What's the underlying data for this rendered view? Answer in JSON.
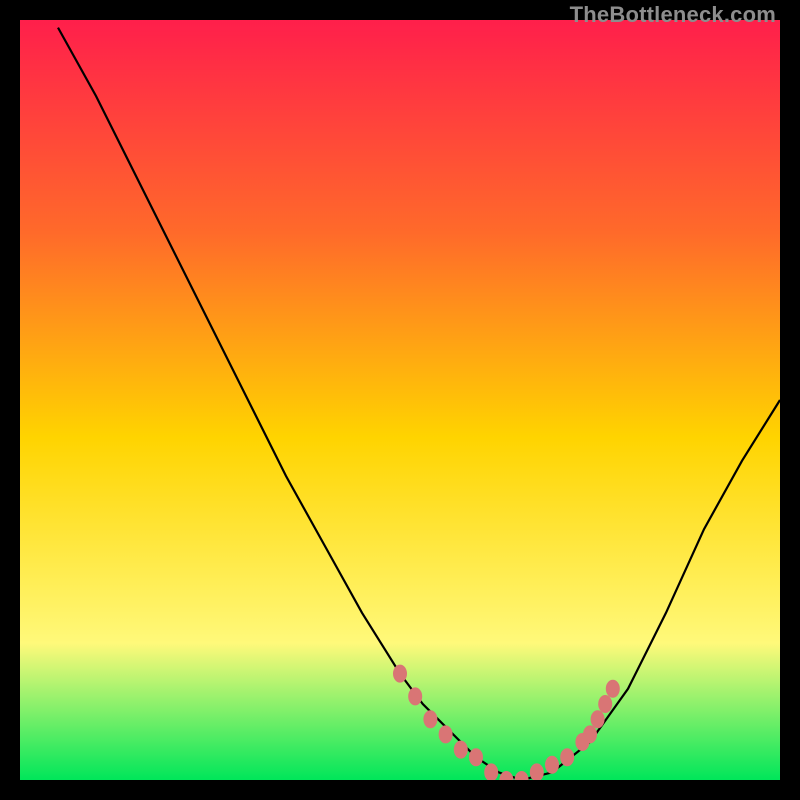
{
  "watermark": "TheBottleneck.com",
  "colors": {
    "gradient_top": "#ff1f4b",
    "gradient_mid_upper": "#ff6a2a",
    "gradient_mid": "#ffd400",
    "gradient_mid_lower": "#fff97a",
    "gradient_bottom": "#00e65a",
    "curve": "#000000",
    "marker": "#d97575",
    "background": "#000000"
  },
  "chart_data": {
    "type": "line",
    "title": "",
    "xlabel": "",
    "ylabel": "",
    "xlim": [
      0,
      100
    ],
    "ylim": [
      0,
      100
    ],
    "series": [
      {
        "name": "bottleneck-curve",
        "x": [
          5,
          10,
          15,
          20,
          25,
          30,
          35,
          40,
          45,
          50,
          53,
          55,
          58,
          60,
          63,
          66,
          70,
          75,
          80,
          85,
          90,
          95,
          100
        ],
        "y": [
          99,
          90,
          80,
          70,
          60,
          50,
          40,
          31,
          22,
          14,
          10,
          8,
          5,
          3,
          1,
          0,
          1,
          5,
          12,
          22,
          33,
          42,
          50
        ]
      }
    ],
    "markers": {
      "name": "highlight-points",
      "x": [
        50,
        52,
        54,
        56,
        58,
        60,
        62,
        64,
        66,
        68,
        70,
        72,
        74,
        75,
        76,
        77,
        78
      ],
      "y": [
        14,
        11,
        8,
        6,
        4,
        3,
        1,
        0,
        0,
        1,
        2,
        3,
        5,
        6,
        8,
        10,
        12
      ]
    }
  }
}
